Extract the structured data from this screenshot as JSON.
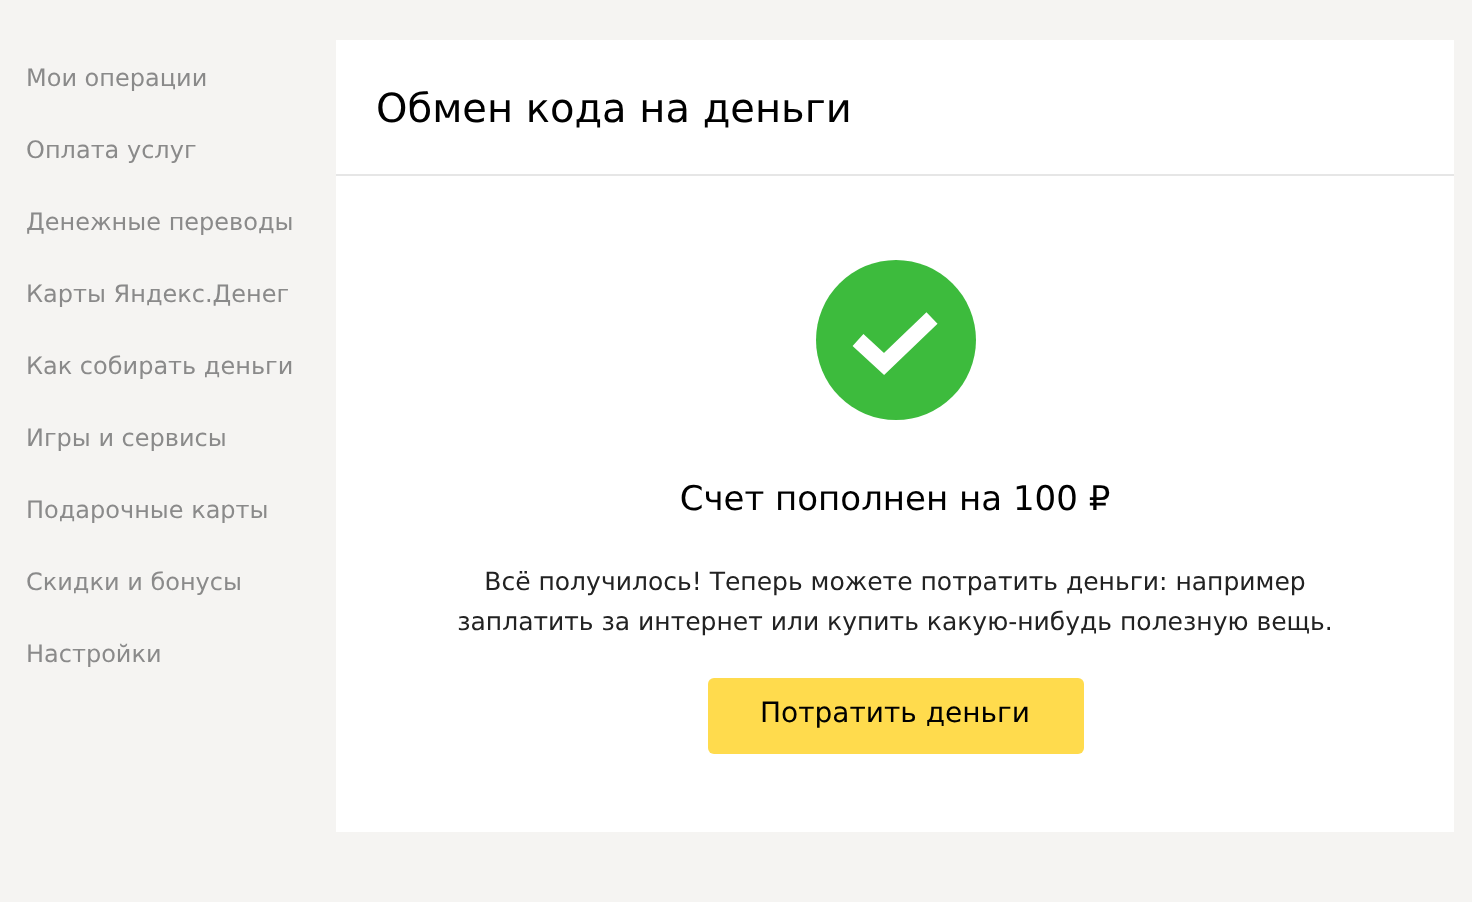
{
  "sidebar": {
    "items": [
      {
        "label": "Мои операции"
      },
      {
        "label": "Оплата услуг"
      },
      {
        "label": "Денежные переводы"
      },
      {
        "label": "Карты Яндекс.Денег"
      },
      {
        "label": "Как собирать деньги"
      },
      {
        "label": "Игры и сервисы"
      },
      {
        "label": "Подарочные карты"
      },
      {
        "label": "Скидки и бонусы"
      },
      {
        "label": "Настройки"
      }
    ]
  },
  "card": {
    "title": "Обмен кода на деньги",
    "succeeded": true,
    "heading": "Счет пополнен на 100 ₽",
    "description_lines": [
      "Всё получилось! Теперь можете потратить деньги: например",
      "заплатить за интернет или купить какую-нибудь полезную вещь."
    ],
    "button": "Потратить деньги"
  }
}
